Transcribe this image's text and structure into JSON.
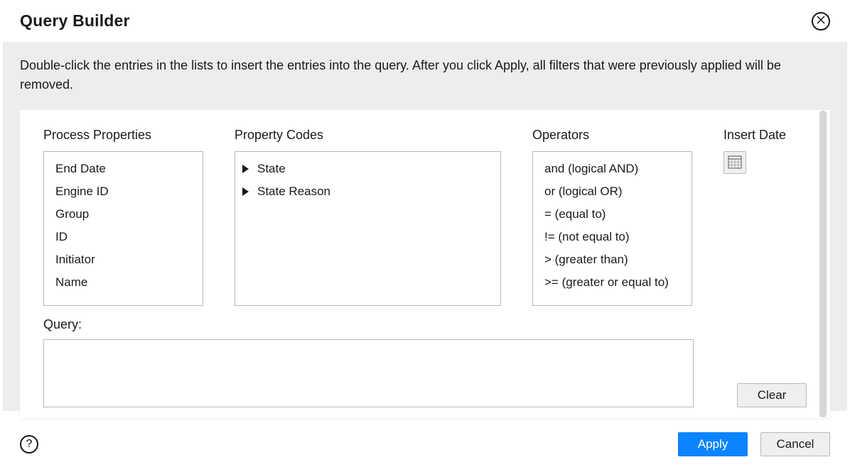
{
  "header": {
    "title": "Query Builder"
  },
  "instructions": "Double-click the entries in the lists to insert the entries into the query. After you click Apply, all filters that were previously applied will be removed.",
  "columns": {
    "process_properties": {
      "label": "Process Properties",
      "items": [
        "End Date",
        "Engine ID",
        "Group",
        "ID",
        "Initiator",
        "Name"
      ]
    },
    "property_codes": {
      "label": "Property Codes",
      "items": [
        "State",
        "State Reason"
      ]
    },
    "operators": {
      "label": "Operators",
      "items": [
        "and (logical AND)",
        "or (logical OR)",
        "= (equal to)",
        "!= (not equal to)",
        "> (greater than)",
        ">= (greater or equal to)"
      ]
    },
    "insert_date": {
      "label": "Insert Date"
    }
  },
  "query": {
    "label": "Query:",
    "value": ""
  },
  "buttons": {
    "clear": "Clear",
    "apply": "Apply",
    "cancel": "Cancel"
  }
}
